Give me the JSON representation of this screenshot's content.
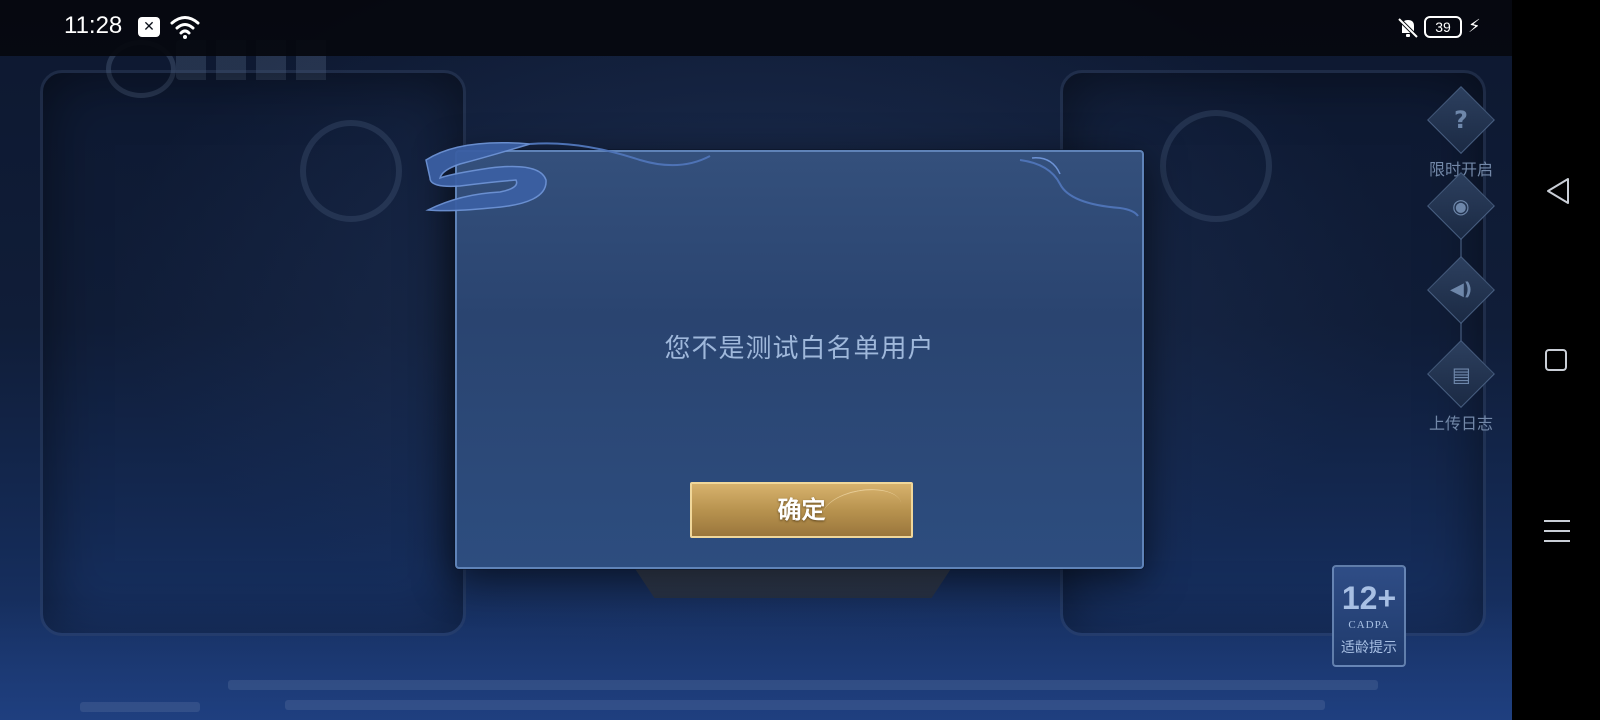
{
  "status_bar": {
    "time": "11:28",
    "notification_icon": "close-box-icon",
    "wifi_icon": "wifi-icon",
    "mute_icon": "notifications-off-icon",
    "battery_level": "39",
    "charging_icon": "charging-bolt-icon"
  },
  "dialog": {
    "message": "您不是测试白名单用户",
    "confirm_label": "确定"
  },
  "side_controls": [
    {
      "icon": "help-icon",
      "glyph": "?",
      "label": "限时开启"
    },
    {
      "icon": "camera-icon",
      "glyph": "◉",
      "label": ""
    },
    {
      "icon": "volume-icon",
      "glyph": "🔈",
      "label": ""
    },
    {
      "icon": "log-upload-icon",
      "glyph": "▤",
      "label": "上传日志"
    }
  ],
  "age_rating": {
    "rating": "12+",
    "org": "CADPA",
    "caption": "适龄提示"
  },
  "colors": {
    "dialog_bg": "#2a4470",
    "dialog_border": "#5f83b8",
    "message_text": "#9fb8db",
    "button_gold": "#c8a35e"
  }
}
